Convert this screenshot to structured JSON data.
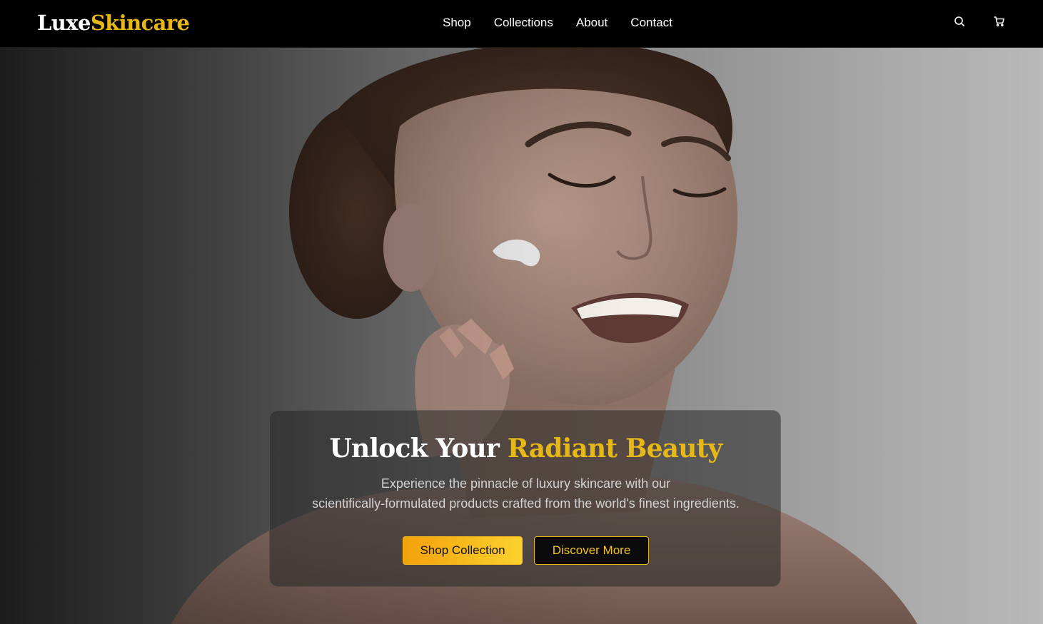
{
  "brand": {
    "name_part1": "Luxe",
    "name_part2": "Skincare",
    "accent_color": "#e6b817"
  },
  "nav": {
    "links": [
      "Shop",
      "Collections",
      "About",
      "Contact"
    ],
    "icons": [
      "search-icon",
      "cart-icon"
    ]
  },
  "hero": {
    "title_part1": "Unlock Your",
    "title_part2": "Radiant Beauty",
    "subtitle_line1": "Experience the pinnacle of luxury skincare with our",
    "subtitle_line2": "scientifically-formulated products crafted from the world's finest ingredients.",
    "primary_button": "Shop Collection",
    "secondary_button": "Discover More",
    "image": "smiling-woman-applying-face-cream"
  }
}
